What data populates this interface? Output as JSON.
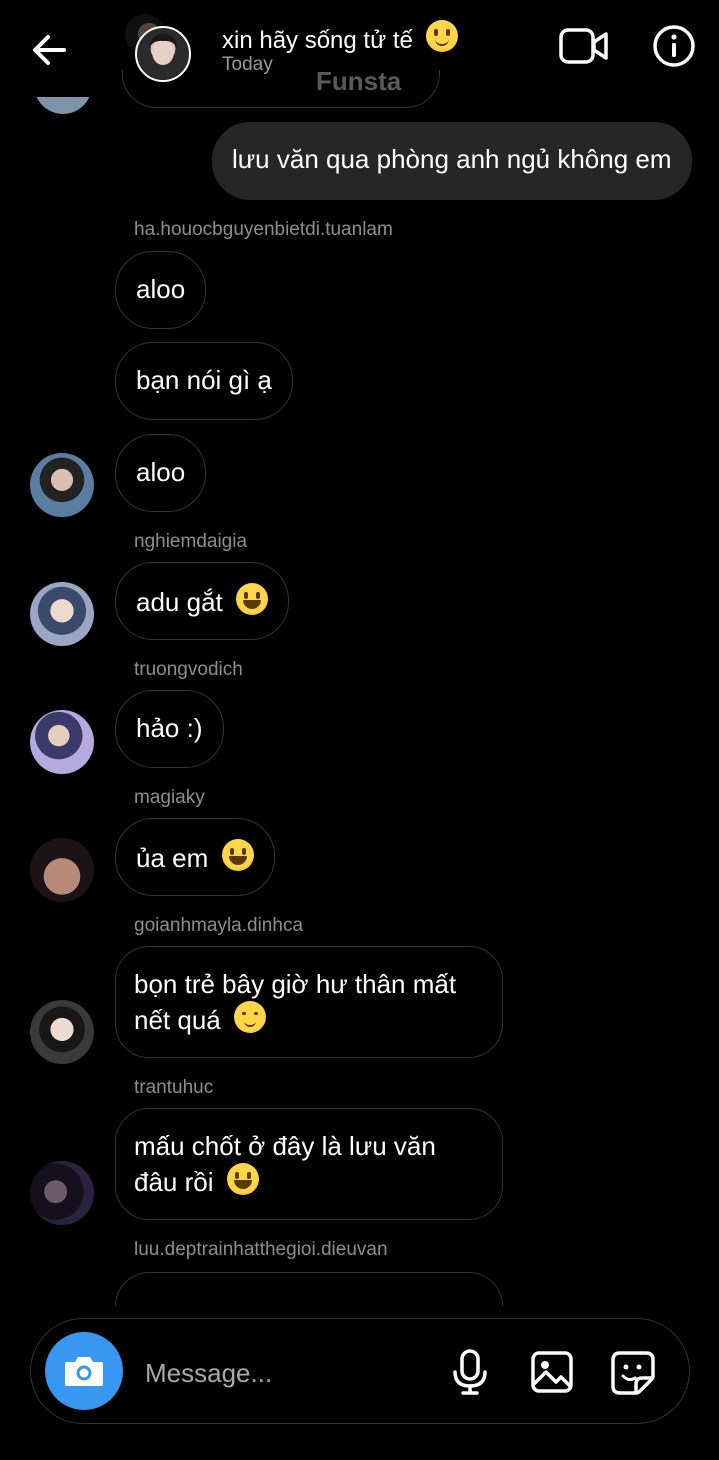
{
  "header": {
    "title": "xin hãy sống tử tế",
    "subtitle": "Today",
    "watermark": "Funsta",
    "icons": [
      "back-arrow-icon",
      "video-call-icon",
      "info-icon"
    ]
  },
  "messages": [
    {
      "sender": "",
      "text": "lưu văn qua phòng anh ngủ không em",
      "outgoing": true
    },
    {
      "sender": "ha.houocbguyenbietdi.tuanlam",
      "text": ""
    },
    {
      "text": "aloo"
    },
    {
      "text": "bạn nói gì ạ"
    },
    {
      "text": "aloo"
    },
    {
      "sender": "nghiemdaigia",
      "text": "adu gắt",
      "emoji": "grinning"
    },
    {
      "sender": "truongvodich",
      "text": "hảo :)"
    },
    {
      "sender": "magiaky",
      "text": "ủa em",
      "emoji": "grinning"
    },
    {
      "sender": "goianhmayla.dinhca",
      "text": "bọn trẻ bây giờ hư thân mất nết quá",
      "emoji": "relieved"
    },
    {
      "sender": "trantuhuc",
      "text": "mấu chốt ở đây là lưu văn đâu rồi",
      "emoji": "grinning"
    },
    {
      "sender": "luu.deptrainhatthegioi.dieuvan",
      "text": ""
    }
  ],
  "composer": {
    "placeholder": "Message...",
    "icons": [
      "camera-icon",
      "microphone-icon",
      "gallery-icon",
      "sticker-icon"
    ]
  },
  "colors": {
    "background": "#000000",
    "accent": "#3897f0",
    "outgoing_bubble": "#262626",
    "border": "#333333",
    "meta": "#8e8e8e"
  }
}
